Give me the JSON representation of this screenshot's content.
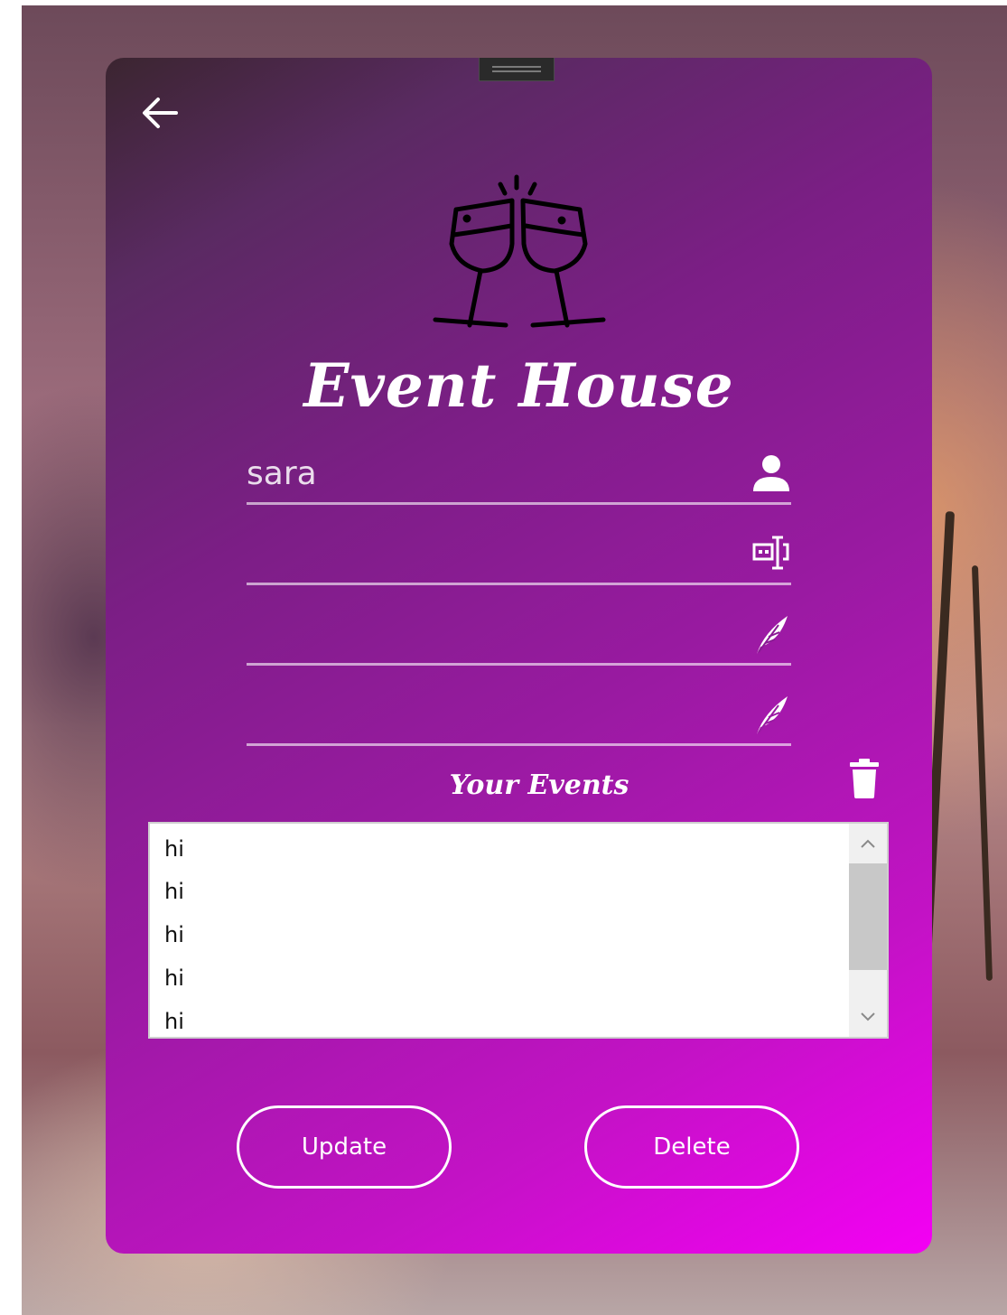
{
  "app": {
    "title": "Event House"
  },
  "form": {
    "username": {
      "value": "sara",
      "placeholder": ""
    },
    "field2": {
      "value": "",
      "placeholder": ""
    },
    "field3": {
      "value": "",
      "placeholder": ""
    },
    "field4": {
      "value": "",
      "placeholder": ""
    }
  },
  "events": {
    "heading": "Your Events",
    "items": [
      "hi",
      "hi",
      "hi",
      "hi",
      "hi"
    ]
  },
  "actions": {
    "update_label": "Update",
    "delete_label": "Delete"
  },
  "icons": {
    "back": "arrow-left-icon",
    "logo": "wine-glasses-cheers-icon",
    "user": "person-icon",
    "text-field": "text-cursor-field-icon",
    "feather": "feather-quill-icon",
    "trash": "trash-icon"
  },
  "colors": {
    "accent": "#ffffff",
    "card_gradient_start": "#3b2530",
    "card_gradient_end": "#f400f4"
  }
}
